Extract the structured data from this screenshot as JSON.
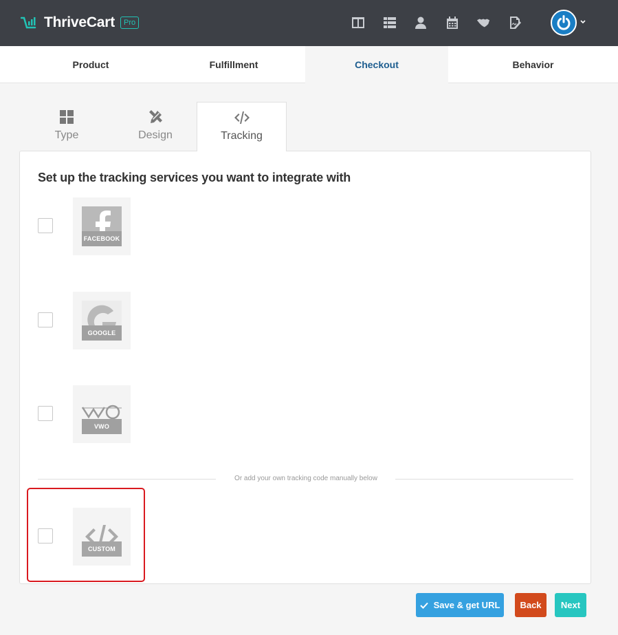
{
  "app": {
    "logo_text": "ThriveCart",
    "logo_badge": "Pro"
  },
  "header": {
    "icons": [
      "layout-icon",
      "list-icon",
      "user-icon",
      "calendar-icon",
      "handshake-icon",
      "signature-icon"
    ]
  },
  "main_tabs": [
    {
      "label": "Product"
    },
    {
      "label": "Fulfillment"
    },
    {
      "label": "Checkout"
    },
    {
      "label": "Behavior"
    }
  ],
  "sub_tabs": [
    {
      "label": "Type"
    },
    {
      "label": "Design"
    },
    {
      "label": "Tracking"
    }
  ],
  "panel": {
    "title": "Set up the tracking services you want to integrate with",
    "services": [
      {
        "label": "FACEBOOK",
        "checked": false
      },
      {
        "label": "GOOGLE",
        "checked": false
      },
      {
        "label": "VWO",
        "checked": false
      }
    ],
    "divider_text": "Or add your own tracking code manually below",
    "custom": {
      "label": "CUSTOM",
      "checked": false
    }
  },
  "buttons": {
    "save": "Save & get URL",
    "back": "Back",
    "next": "Next"
  },
  "colors": {
    "header_bg": "#3d4046",
    "accent_teal": "#22c3b5",
    "active_tab": "#1d5d8f",
    "save": "#35a1e0",
    "back": "#d24a1c",
    "next": "#27c6c0",
    "highlight": "#d9191f"
  }
}
